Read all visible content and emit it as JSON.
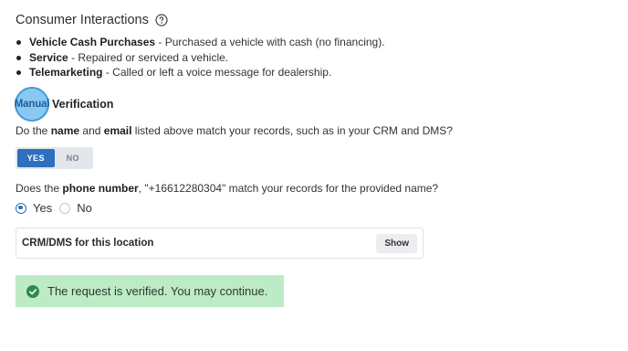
{
  "section": {
    "title": "Consumer Interactions",
    "help_icon": "question-circle-icon"
  },
  "interactions": [
    {
      "label": "Vehicle Cash Purchases",
      "description": " - Purchased a vehicle with cash (no financing)."
    },
    {
      "label": "Service",
      "description": " - Repaired or serviced a vehicle."
    },
    {
      "label": "Telemarketing",
      "description": " - Called or left a voice message for dealership."
    }
  ],
  "manual_verification": {
    "highlight_label": "Manual",
    "label": "Verification"
  },
  "question1": {
    "prefix": "Do the ",
    "name_word": "name",
    "mid": " and ",
    "email_word": "email",
    "suffix": " listed above match your records, such as in your CRM and DMS?",
    "yes_label": "YES",
    "no_label": "NO",
    "selected": "YES"
  },
  "question2": {
    "prefix": "Does the ",
    "phone_word": "phone number",
    "suffix": ", \"+16612280304\" match your records for the provided name?",
    "options": [
      "Yes",
      "No"
    ],
    "selected": "Yes"
  },
  "crm": {
    "title": "CRM/DMS for this location",
    "show_label": "Show"
  },
  "status": {
    "message": "The request is verified. You may continue.",
    "icon": "check-circle-icon",
    "color": "#bdebc6"
  },
  "colors": {
    "accent": "#2f6fbf",
    "success_icon": "#2e8b4a"
  }
}
